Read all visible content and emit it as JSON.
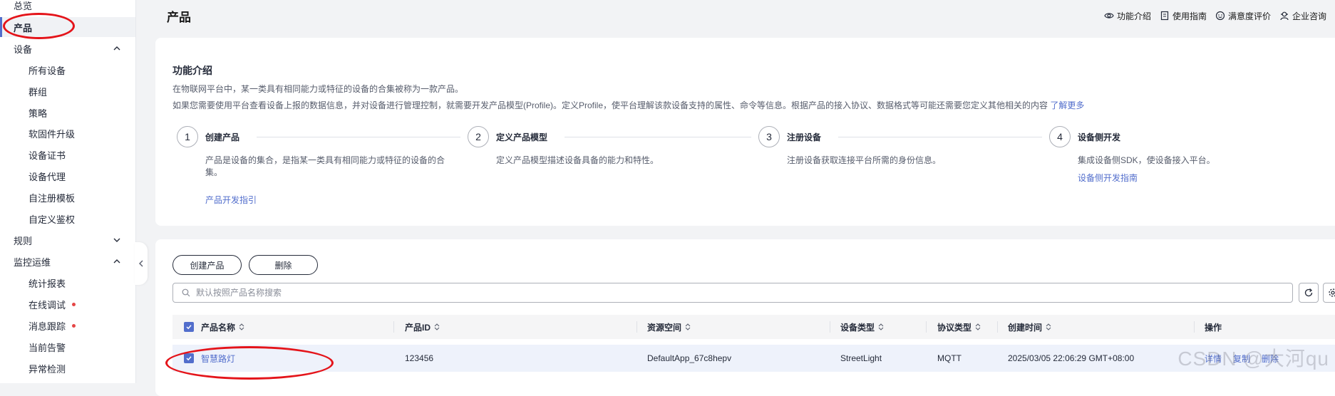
{
  "sidebar": {
    "items": [
      {
        "label": "总览"
      },
      {
        "label": "产品"
      },
      {
        "label": "设备"
      },
      {
        "label": "所有设备"
      },
      {
        "label": "群组"
      },
      {
        "label": "策略"
      },
      {
        "label": "软固件升级"
      },
      {
        "label": "设备证书"
      },
      {
        "label": "设备代理"
      },
      {
        "label": "自注册模板"
      },
      {
        "label": "自定义鉴权"
      },
      {
        "label": "规则"
      },
      {
        "label": "监控运维"
      },
      {
        "label": "统计报表"
      },
      {
        "label": "在线调试"
      },
      {
        "label": "消息跟踪"
      },
      {
        "label": "当前告警"
      },
      {
        "label": "异常检测"
      }
    ]
  },
  "header": {
    "title": "产品",
    "links": [
      {
        "label": "功能介绍",
        "icon": "eye-icon"
      },
      {
        "label": "使用指南",
        "icon": "document-icon"
      },
      {
        "label": "满意度评价",
        "icon": "smiley-icon"
      },
      {
        "label": "企业咨询",
        "icon": "support-icon"
      }
    ]
  },
  "intro": {
    "title": "功能介绍",
    "desc1": "在物联网平台中，某一类具有相同能力或特征的设备的合集被称为一款产品。",
    "desc2": "如果您需要使用平台查看设备上报的数据信息，并对设备进行管理控制，就需要开发产品模型(Profile)。定义Profile，使平台理解该款设备支持的属性、命令等信息。根据产品的接入协议、数据格式等可能还需要您定义其他相关的内容",
    "learn_more": "了解更多",
    "steps": [
      {
        "num": "1",
        "title": "创建产品",
        "desc": "产品是设备的集合，是指某一类具有相同能力或特征的设备的合集。",
        "link": "产品开发指引"
      },
      {
        "num": "2",
        "title": "定义产品模型",
        "desc": "定义产品模型描述设备具备的能力和特性。",
        "link": ""
      },
      {
        "num": "3",
        "title": "注册设备",
        "desc": "注册设备获取连接平台所需的身份信息。",
        "link": ""
      },
      {
        "num": "4",
        "title": "设备侧开发",
        "desc": "集成设备侧SDK，使设备接入平台。",
        "link": "设备侧开发指南"
      }
    ]
  },
  "toolbar": {
    "create_label": "创建产品",
    "delete_label": "删除",
    "search_placeholder": "默认按照产品名称搜索"
  },
  "table": {
    "columns": [
      "产品名称",
      "产品ID",
      "资源空间",
      "设备类型",
      "协议类型",
      "创建时间",
      "操作"
    ],
    "rows": [
      {
        "name": "智慧路灯",
        "id": "123456",
        "space": "DefaultApp_67c8hepv",
        "device_type": "StreetLight",
        "protocol": "MQTT",
        "created": "2025/03/05 22:06:29 GMT+08:00",
        "actions": [
          "详情",
          "复制",
          "删除"
        ]
      }
    ]
  },
  "watermark": "CSDN @大河qu",
  "colors": {
    "accent": "#526ecc",
    "annotation": "#e4141a",
    "alert_dot": "#e54545"
  }
}
